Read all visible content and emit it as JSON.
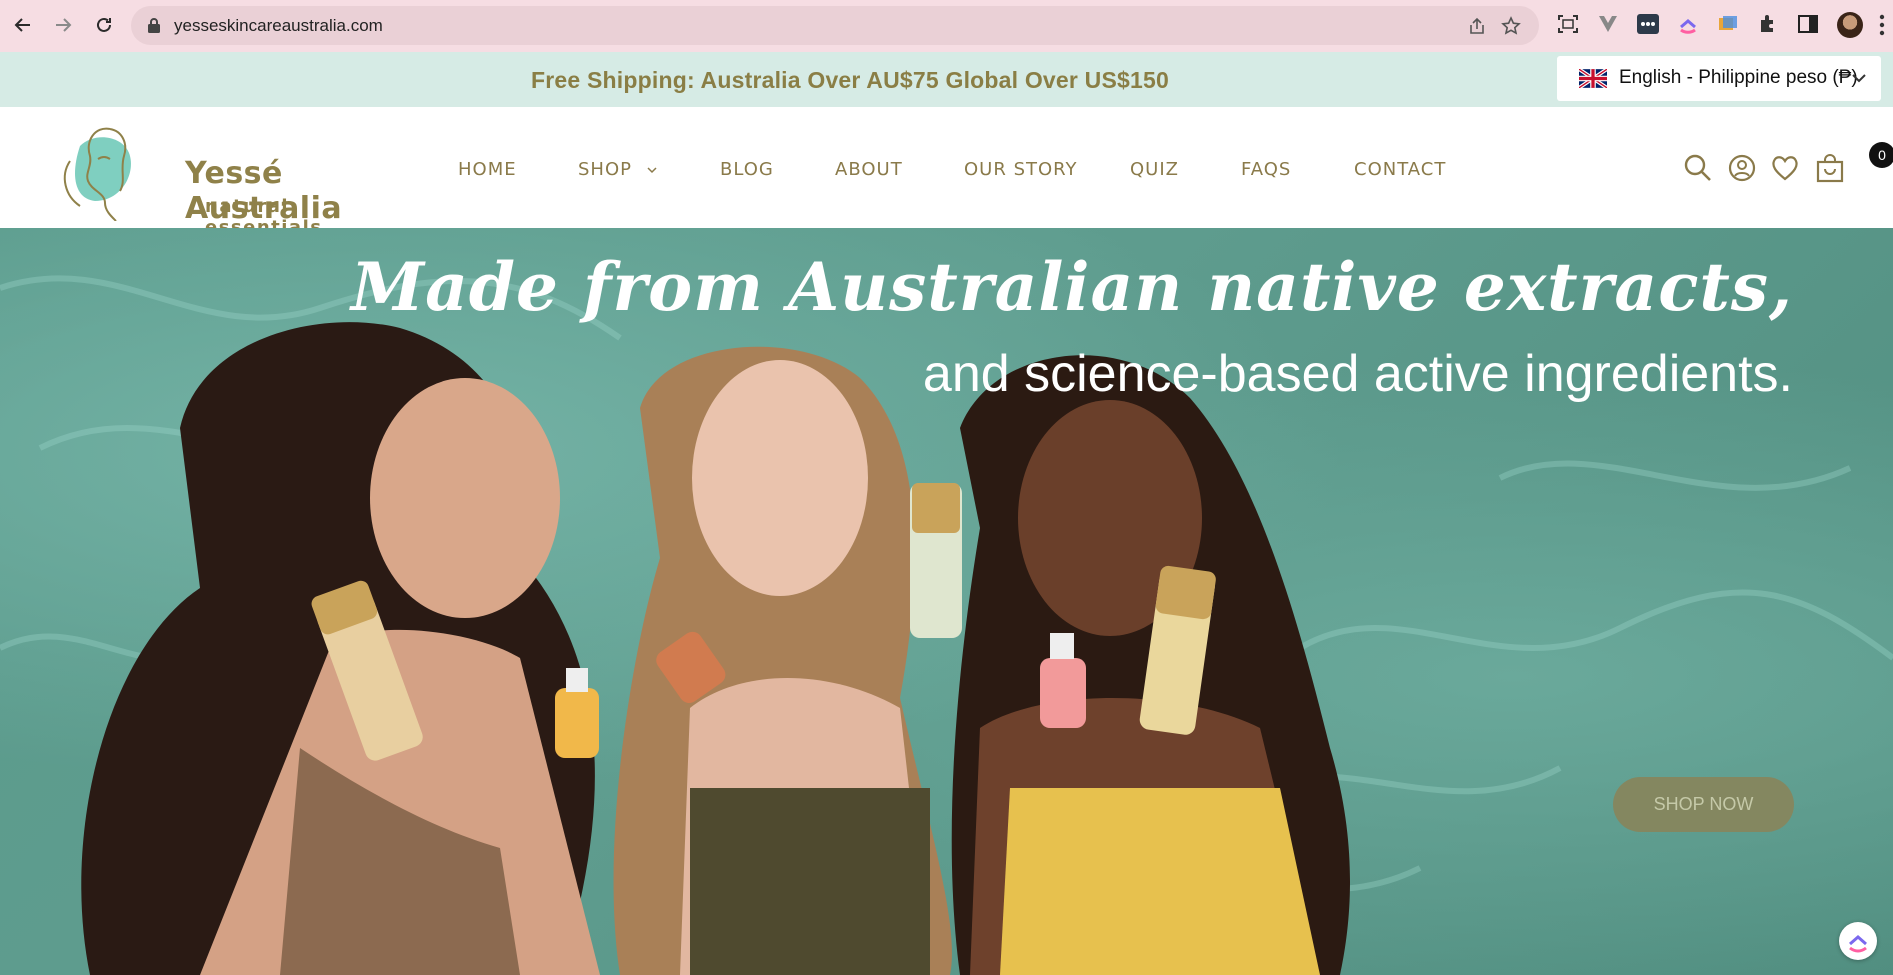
{
  "browser": {
    "url": "yesseskincareaustralia.com"
  },
  "announcement": {
    "text": "Free Shipping: Australia Over AU$75 Global Over US$150"
  },
  "language_selector": {
    "label": "English - Philippine peso (₱)"
  },
  "header": {
    "logo_name": "Yessé Australia",
    "logo_sub": "natural essentials",
    "menu": [
      {
        "label": "HOME"
      },
      {
        "label": "SHOP"
      },
      {
        "label": "BLOG"
      },
      {
        "label": "ABOUT"
      },
      {
        "label": "OUR STORY"
      },
      {
        "label": "QUIZ"
      },
      {
        "label": "FAQS"
      },
      {
        "label": "CONTACT"
      }
    ],
    "cart_count": "0"
  },
  "hero": {
    "headline": "Made from Australian native extracts,",
    "subline": "and science-based active ingredients.",
    "cta": "SHOP NOW"
  },
  "colors": {
    "announce_bg": "#d6ebe5",
    "brand_gold": "#8f8149",
    "hero_teal": "#5a9a8b",
    "cta_bg": "#848760"
  }
}
